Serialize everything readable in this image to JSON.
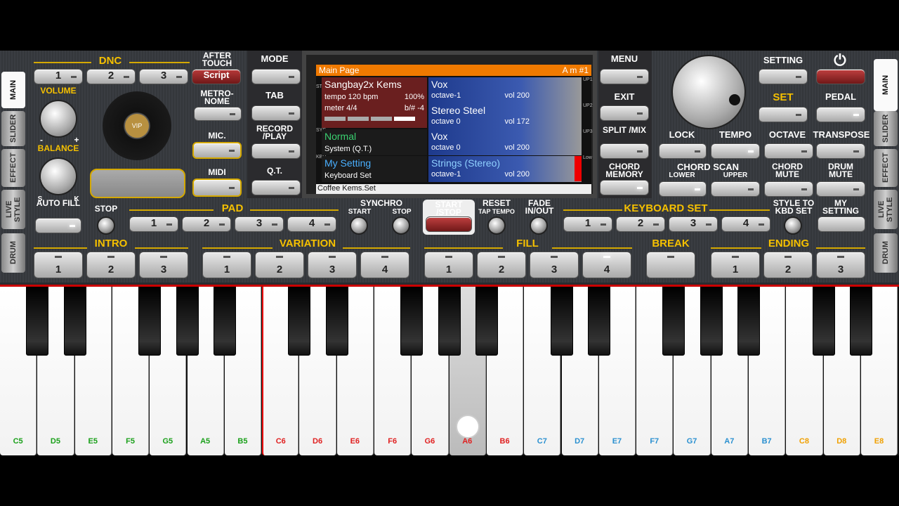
{
  "side_tabs_left": [
    "MAIN",
    "SLIDER",
    "EFFECT",
    "LIVE STYLE",
    "DRUM"
  ],
  "side_tabs_right": [
    "MAIN",
    "SLIDER",
    "EFFECT",
    "LIVE STYLE",
    "DRUM"
  ],
  "dnc": {
    "title": "DNC",
    "buttons": [
      "1",
      "2",
      "3"
    ],
    "script": "Script"
  },
  "after_touch": "AFTER TOUCH",
  "volume": "VOLUME",
  "balance": "BALANCE",
  "balance_marks": {
    "minus": "-",
    "plus": "+",
    "s": "S",
    "k": "K"
  },
  "vip": "VIP",
  "metronome": "METRO-NOME",
  "mic": "MIC.",
  "midi": "MIDI",
  "left_col": {
    "mode": "MODE",
    "tab": "TAB",
    "record": "RECORD /PLAY",
    "qt": "Q.T."
  },
  "screen": {
    "title": "Main Page",
    "chord": "A m #1",
    "style_name": "Sangbay2x Kems",
    "tempo": "tempo 120 bpm",
    "percent": "100%",
    "meter": "meter 4/4",
    "key": "b/# -4",
    "sys_name": "Normal",
    "sys_sub": "System (Q.T.)",
    "kbd_name": "My Setting",
    "kbd_sub": "Keyboard Set",
    "footer": "Coffee Kems.Set",
    "parts": [
      {
        "name": "Vox",
        "octave": "octave-1",
        "vol": "vol 200"
      },
      {
        "name": "Stereo Steel",
        "octave": "octave 0",
        "vol": "vol 172"
      },
      {
        "name": "Vox",
        "octave": "octave 0",
        "vol": "vol 200"
      },
      {
        "name": "Strings (Stereo)",
        "octave": "octave-1",
        "vol": "vol 200"
      }
    ],
    "side_left": [
      "STYLE",
      "SYS",
      "KBD"
    ],
    "side_right": [
      "UP1",
      "UP2",
      "UP3",
      "Low"
    ]
  },
  "right_col": {
    "menu": "MENU",
    "exit": "EXIT",
    "split": "SPLIT /MIX",
    "chord_memory": "CHORD MEMORY"
  },
  "setting": "SETTING",
  "set": "SET",
  "pedal": "PEDAL",
  "power": "⏻",
  "row2": [
    "LOCK",
    "TEMPO",
    "OCTAVE",
    "TRANSPOSE"
  ],
  "chord_scan": {
    "title": "CHORD SCAN",
    "lower": "LOWER",
    "upper": "UPPER"
  },
  "chord_mute": "CHORD MUTE",
  "drum_mute": "DRUM MUTE",
  "auto_fill": "AUTO FILL",
  "stop": "STOP",
  "pad": {
    "title": "PAD",
    "buttons": [
      "1",
      "2",
      "3",
      "4"
    ]
  },
  "synchro": {
    "title": "SYNCHRO",
    "start": "START",
    "stop": "STOP"
  },
  "start_stop": "START /STOP",
  "reset": {
    "title": "RESET",
    "sub": "TAP TEMPO"
  },
  "fade": "FADE IN/OUT",
  "keyboard_set": {
    "title": "KEYBOARD SET",
    "buttons": [
      "1",
      "2",
      "3",
      "4"
    ]
  },
  "style_to_kbd": "STYLE TO KBD SET",
  "my_setting": "MY SETTING",
  "intro": {
    "title": "INTRO",
    "buttons": [
      "1",
      "2",
      "3"
    ]
  },
  "variation": {
    "title": "VARIATION",
    "buttons": [
      "1",
      "2",
      "3",
      "4"
    ]
  },
  "fill": {
    "title": "FILL",
    "buttons": [
      "1",
      "2",
      "3",
      "4"
    ]
  },
  "break": "BREAK",
  "ending": {
    "title": "ENDING",
    "buttons": [
      "1",
      "2",
      "3"
    ]
  },
  "keys": [
    {
      "label": "C5",
      "color": "#1aa01a"
    },
    {
      "label": "D5",
      "color": "#1aa01a"
    },
    {
      "label": "E5",
      "color": "#1aa01a"
    },
    {
      "label": "F5",
      "color": "#1aa01a"
    },
    {
      "label": "G5",
      "color": "#1aa01a"
    },
    {
      "label": "A5",
      "color": "#1aa01a"
    },
    {
      "label": "B5",
      "color": "#1aa01a"
    },
    {
      "label": "C6",
      "color": "#e02020"
    },
    {
      "label": "D6",
      "color": "#e02020"
    },
    {
      "label": "E6",
      "color": "#e02020"
    },
    {
      "label": "F6",
      "color": "#e02020"
    },
    {
      "label": "G6",
      "color": "#e02020"
    },
    {
      "label": "A6",
      "color": "#e02020"
    },
    {
      "label": "B6",
      "color": "#e02020"
    },
    {
      "label": "C7",
      "color": "#2a90d0"
    },
    {
      "label": "D7",
      "color": "#2a90d0"
    },
    {
      "label": "E7",
      "color": "#2a90d0"
    },
    {
      "label": "F7",
      "color": "#2a90d0"
    },
    {
      "label": "G7",
      "color": "#2a90d0"
    },
    {
      "label": "A7",
      "color": "#2a90d0"
    },
    {
      "label": "B7",
      "color": "#2a90d0"
    },
    {
      "label": "C8",
      "color": "#f0a000"
    },
    {
      "label": "D8",
      "color": "#f0a000"
    },
    {
      "label": "E8",
      "color": "#f0a000"
    }
  ],
  "pressed_key": "A6"
}
